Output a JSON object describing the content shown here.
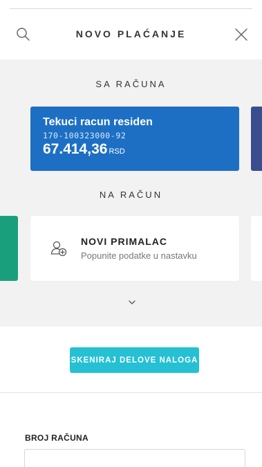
{
  "header": {
    "title": "NOVO PLAĆANJE",
    "search_icon": "search-icon",
    "close_icon": "close-icon"
  },
  "from_account": {
    "section_label": "SA RAČUNA",
    "name": "Tekuci racun residen",
    "number": "170-100323000-92",
    "balance": "67.414,36",
    "currency": "RSD",
    "card_color": "#1d6fc4"
  },
  "to_account": {
    "section_label": "NA RAČUN",
    "recipient_title": "NOVI PRIMALAC",
    "recipient_subtitle": "Popunite podatke u nastavku",
    "icon": "add-user-icon",
    "expand_icon": "chevron-down-icon"
  },
  "scan_button": {
    "label": "SKENIRAJ DELOVE NALOGA",
    "color": "#25c0d4"
  },
  "form": {
    "account_number_label": "BROJ RAČUNA",
    "account_number_value": "",
    "account_number_placeholder": ""
  }
}
